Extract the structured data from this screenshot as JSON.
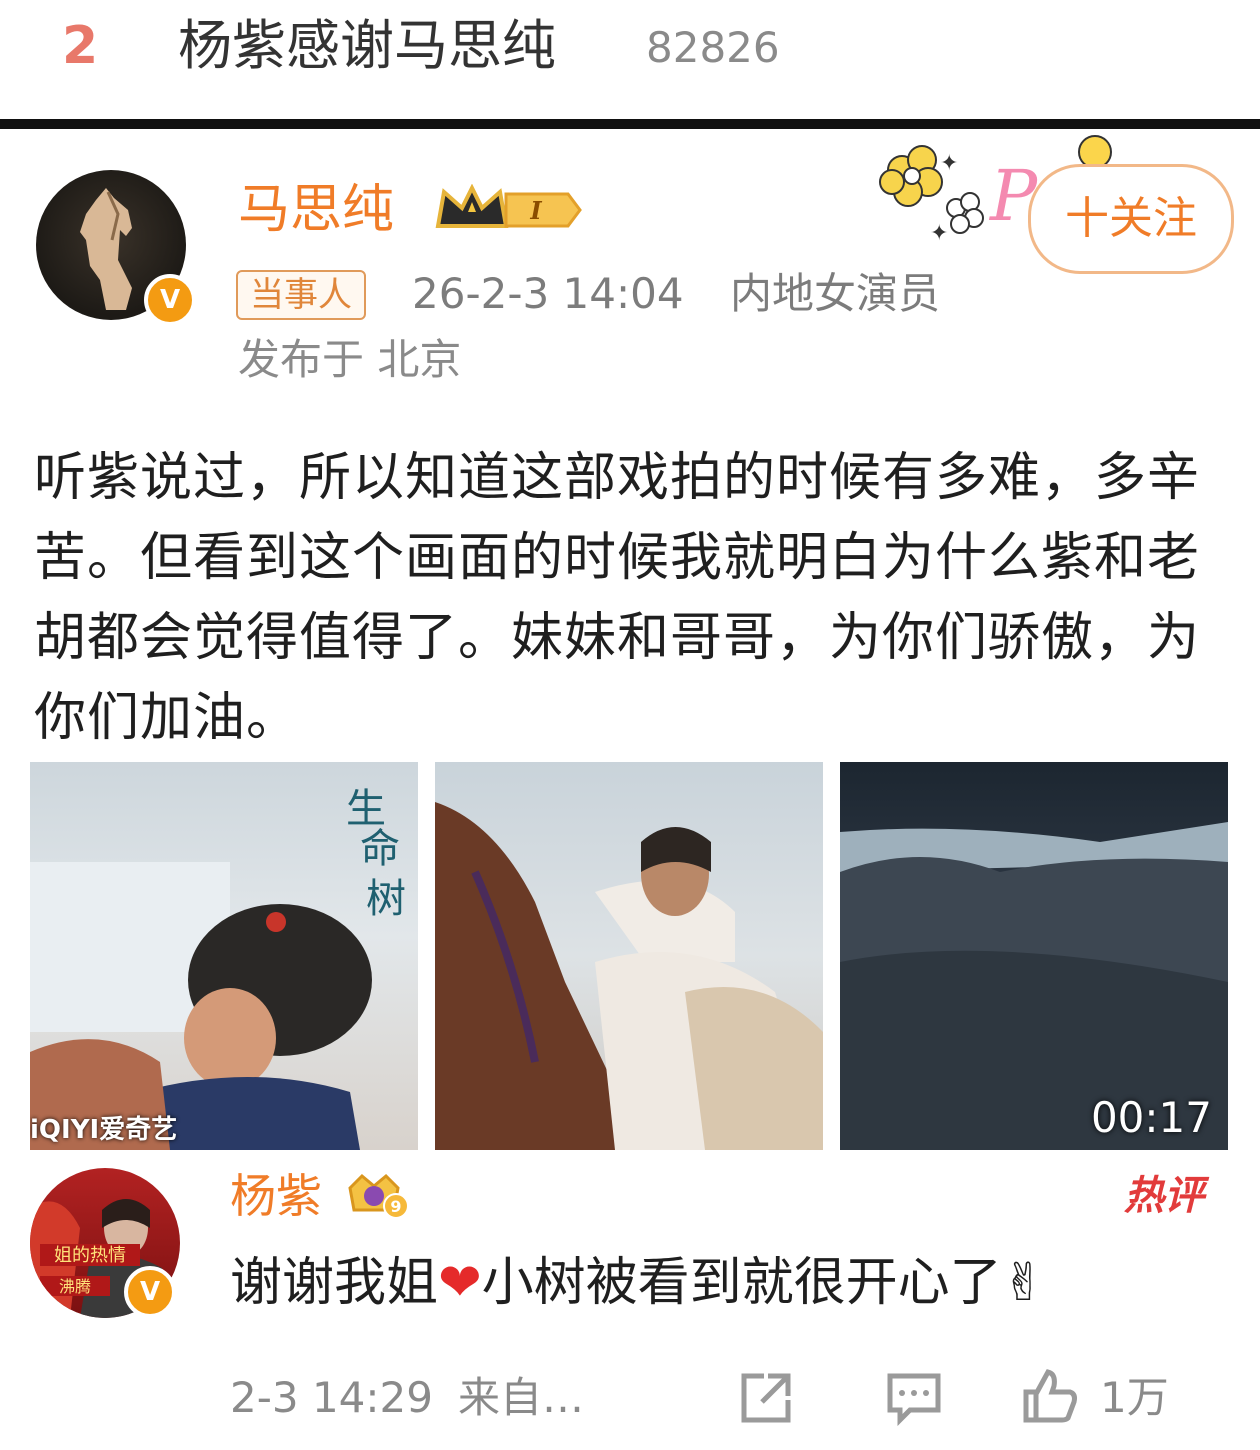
{
  "hot_search": {
    "rank": "2",
    "title": "杨紫感谢马思纯",
    "count": "82826"
  },
  "post": {
    "author": "马思纯",
    "role_tag": "当事人",
    "time": "26-2-3 14:04",
    "author_role": "内地女演员",
    "location": "发布于 北京",
    "follow_label": "十关注",
    "text": "听紫说过，所以知道这部戏拍的时候有多难，多辛苦。但看到这个画面的时候我就明白为什么紫和老胡都会觉得值得了。妹妹和哥哥，为你们骄傲，为你们加油。",
    "video_duration": "00:17",
    "image1_watermark": "iQIYI爱奇艺"
  },
  "hot_comment": {
    "author": "杨紫",
    "hot_label": "热评",
    "text_before": "谢谢我姐",
    "heart": "❤",
    "text_after": "小树被看到就很开心了",
    "emoji": "✌",
    "time": "2-3 14:29",
    "source": "来自…",
    "like_count": "1万"
  },
  "colors": {
    "accent": "#f07c28",
    "verified": "#f49b12",
    "hot": "#e23b3b",
    "rank": "#e8786a"
  },
  "icons": [
    "crown-level-icon",
    "verified-icon",
    "share-icon",
    "comment-icon",
    "like-icon",
    "level-badge-icon"
  ]
}
